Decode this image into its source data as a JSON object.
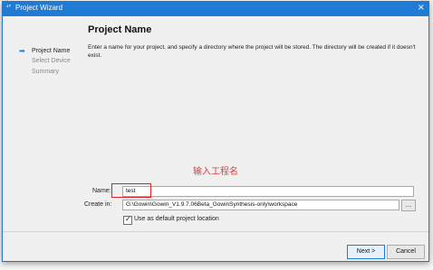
{
  "window": {
    "title": "Project Wizard",
    "close_label": "×"
  },
  "sidebar": {
    "items": [
      "Project Name",
      "Select Device",
      "Summary"
    ]
  },
  "page": {
    "title": "Project Name",
    "description": "Enter a name for your project, and specify a directory where the project will be stored. The directory will be created if it doesn't exist."
  },
  "annotation": "输入工程名",
  "form": {
    "name_label": "Name:",
    "name_value": "test",
    "create_in_label": "Create in:",
    "create_in_value": "G:\\Gowin\\Gowin_V1.9.7.06Beta_GowinSynthesis-only\\workspace",
    "browse_label": "...",
    "default_location_label": "Use as default project location",
    "default_location_checked": true
  },
  "buttons": {
    "next": "Next >",
    "cancel": "Cancel"
  }
}
